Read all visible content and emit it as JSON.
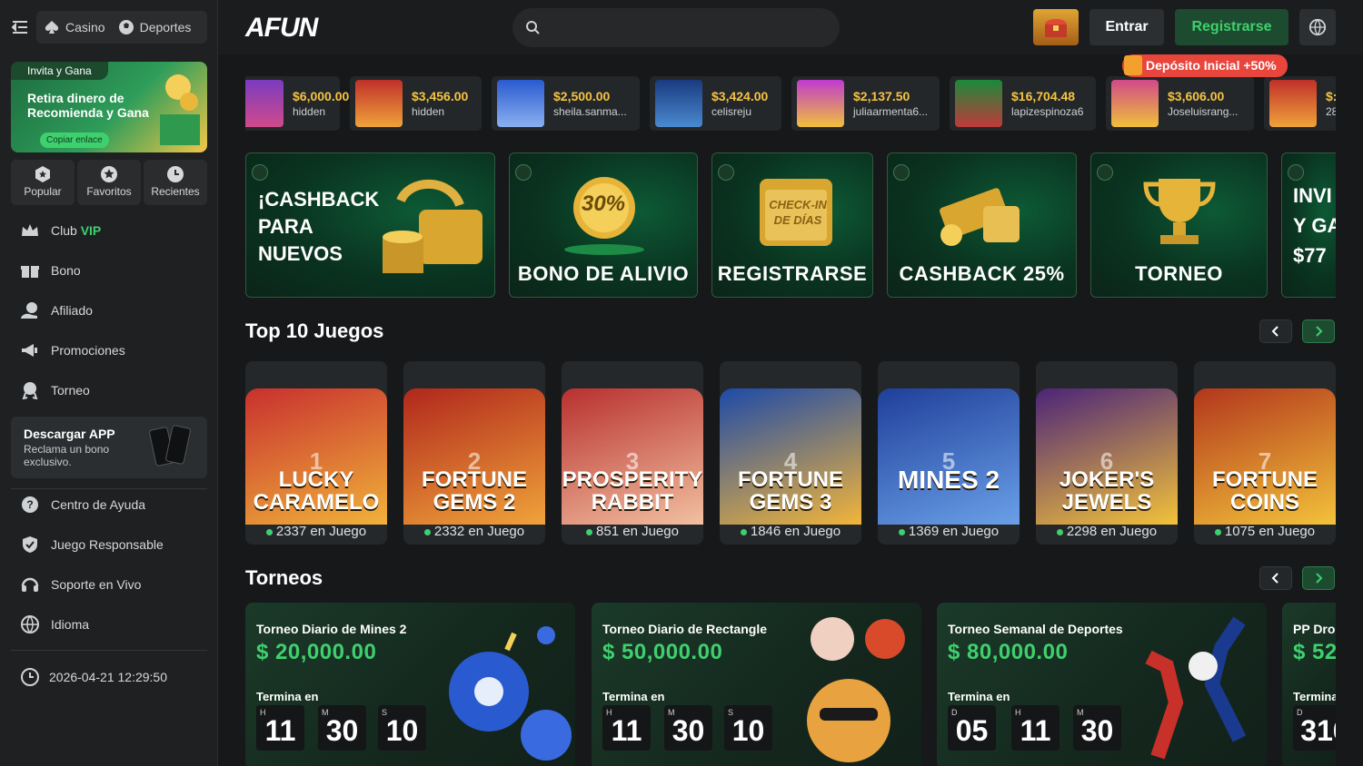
{
  "header": {
    "nav_casino": "Casino",
    "nav_sports": "Deportes",
    "logo": "AFUN",
    "login_label": "Entrar",
    "register_label": "Registrarse",
    "deposit_badge": "Depósito Inicial +50%"
  },
  "sidebar": {
    "promo": {
      "pill": "Invita y Gana",
      "title": "Retira dinero de Recomienda y Gana",
      "button": "Copiar enlace"
    },
    "quick": [
      {
        "label": "Popular"
      },
      {
        "label": "Favoritos"
      },
      {
        "label": "Recientes"
      }
    ],
    "club_label": "Club",
    "club_vip": "VIP",
    "nav": [
      {
        "label": "Bono"
      },
      {
        "label": "Afiliado"
      },
      {
        "label": "Promociones"
      },
      {
        "label": "Torneo"
      }
    ],
    "download": {
      "title": "Descargar APP",
      "subtitle": "Reclama un bono exclusivo."
    },
    "nav2": [
      {
        "label": "Centro de Ayuda"
      },
      {
        "label": "Juego Responsable"
      },
      {
        "label": "Soporte en Vivo"
      },
      {
        "label": "Idioma"
      }
    ],
    "datetime": "2026-04-21 12:29:50"
  },
  "wins": [
    {
      "amount": "$6,000.00",
      "user": "hidden"
    },
    {
      "amount": "$3,456.00",
      "user": "hidden"
    },
    {
      "amount": "$2,500.00",
      "user": "sheila.sanma..."
    },
    {
      "amount": "$3,424.00",
      "user": "celisreju"
    },
    {
      "amount": "$2,137.50",
      "user": "juliaarmenta6..."
    },
    {
      "amount": "$16,704.48",
      "user": "lapizespinoza6"
    },
    {
      "amount": "$3,606.00",
      "user": "Joseluisrang..."
    },
    {
      "amount": "$:",
      "user": "28"
    }
  ],
  "banners": [
    {
      "text": "¡CASHBACK PARA NUEVOS"
    },
    {
      "text": "BONO DE ALIVIO",
      "art": "30%"
    },
    {
      "text": "REGISTRARSE",
      "art": "CHECK-IN DE DÍAS"
    },
    {
      "text": "CASHBACK 25%"
    },
    {
      "text": "TORNEO"
    },
    {
      "text": "INVI Y GA $77"
    }
  ],
  "top10": {
    "title": "Top 10 Juegos",
    "games": [
      {
        "rank": "1",
        "name": "LUCKY CARAMELO",
        "playing": "2337 en Juego",
        "c1": "#c8302e",
        "c2": "#f0b23a"
      },
      {
        "rank": "2",
        "name": "FORTUNE GEMS 2",
        "playing": "2332 en Juego",
        "c1": "#b0271c",
        "c2": "#f0a33a"
      },
      {
        "rank": "3",
        "name": "PROSPERITY RABBIT",
        "playing": "851 en Juego",
        "c1": "#b8302f",
        "c2": "#f2c0a0"
      },
      {
        "rank": "4",
        "name": "FORTUNE GEMS 3",
        "playing": "1846 en Juego",
        "c1": "#1d4aa8",
        "c2": "#f2b53a"
      },
      {
        "rank": "5",
        "name": "MINES 2",
        "playing": "1369 en Juego",
        "c1": "#1f3f9a",
        "c2": "#6aa0e8"
      },
      {
        "rank": "6",
        "name": "JOKER'S JEWELS",
        "playing": "2298 en Juego",
        "c1": "#4b2478",
        "c2": "#f3c23a"
      },
      {
        "rank": "7",
        "name": "FORTUNE COINS",
        "playing": "1075 en Juego",
        "c1": "#b2371c",
        "c2": "#f3c23a"
      }
    ]
  },
  "tournaments": {
    "title": "Torneos",
    "ends_label": "Termina en",
    "items": [
      {
        "name": "Torneo Diario de Mines 2",
        "prize": "$ 20,000.00",
        "cd": [
          {
            "u": "H",
            "v": "11"
          },
          {
            "u": "M",
            "v": "30"
          },
          {
            "u": "S",
            "v": "10"
          }
        ]
      },
      {
        "name": "Torneo Diario de Rectangle",
        "prize": "$ 50,000.00",
        "cd": [
          {
            "u": "H",
            "v": "11"
          },
          {
            "u": "M",
            "v": "30"
          },
          {
            "u": "S",
            "v": "10"
          }
        ]
      },
      {
        "name": "Torneo Semanal de Deportes",
        "prize": "$ 80,000.00",
        "cd": [
          {
            "u": "D",
            "v": "05"
          },
          {
            "u": "H",
            "v": "11"
          },
          {
            "u": "M",
            "v": "30"
          }
        ]
      },
      {
        "name": "PP Dro",
        "prize": "$ 52",
        "ends": "Termina",
        "cd": [
          {
            "u": "D",
            "v": "316"
          }
        ]
      }
    ]
  },
  "colors": {
    "accent": "#3fd06e",
    "gold": "#f6c341",
    "bg": "#16181a",
    "deposit": "#e8453c"
  }
}
